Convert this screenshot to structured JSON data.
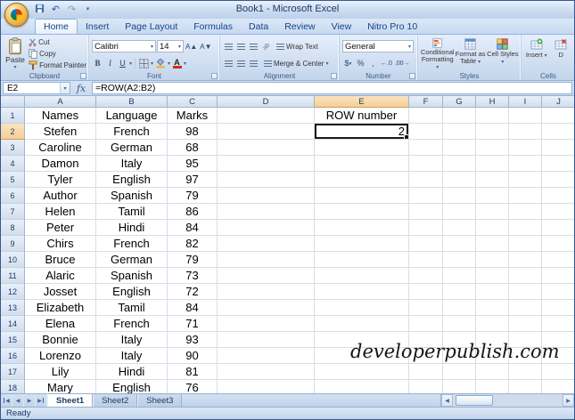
{
  "window": {
    "title": "Book1 - Microsoft Excel"
  },
  "icons": {
    "dropdown": "▾",
    "undo": "↶",
    "redo": "↷",
    "prev": "◀",
    "next": "▶",
    "letter_a": "A",
    "orientation": "ab",
    "increase_font": "A▲",
    "decrease_font": "A▼",
    "currency": "$",
    "percent": "%",
    "comma": ",",
    "increase_decimal": "←.0",
    "decrease_decimal": ".00→"
  },
  "ribbon": {
    "tabs": [
      {
        "label": "Home",
        "active": true
      },
      {
        "label": "Insert"
      },
      {
        "label": "Page Layout"
      },
      {
        "label": "Formulas"
      },
      {
        "label": "Data"
      },
      {
        "label": "Review"
      },
      {
        "label": "View"
      },
      {
        "label": "Nitro Pro 10"
      }
    ],
    "clipboard": {
      "group": "Clipboard",
      "paste": "Paste",
      "cut": "Cut",
      "copy": "Copy",
      "format_painter": "Format Painter"
    },
    "font": {
      "group": "Font",
      "family": "Calibri",
      "size": "14",
      "bold": "B",
      "italic": "I",
      "underline": "U"
    },
    "alignment": {
      "group": "Alignment",
      "wrap_text": "Wrap Text",
      "merge_center": "Merge & Center"
    },
    "number": {
      "group": "Number",
      "format": "General"
    },
    "styles": {
      "group": "Styles",
      "conditional": "Conditional Formatting",
      "format_table": "Format as Table",
      "cell_styles": "Cell Styles"
    },
    "cells": {
      "group": "Cells",
      "insert": "Insert",
      "delete": "D"
    }
  },
  "formula_bar": {
    "name_box": "E2",
    "fx": "fx",
    "formula": "=ROW(A2:B2)"
  },
  "grid": {
    "columns": [
      "A",
      "B",
      "C",
      "D",
      "E",
      "F",
      "G",
      "H",
      "I",
      "J"
    ],
    "selected": {
      "cell": "E2",
      "col": "E",
      "row": 2
    },
    "rows": [
      {
        "n": 1,
        "A": "Names",
        "B": "Language",
        "C": "Marks",
        "E": "ROW number"
      },
      {
        "n": 2,
        "A": "Stefen",
        "B": "French",
        "C": "98",
        "E": "2"
      },
      {
        "n": 3,
        "A": "Caroline",
        "B": "German",
        "C": "68"
      },
      {
        "n": 4,
        "A": "Damon",
        "B": "Italy",
        "C": "95"
      },
      {
        "n": 5,
        "A": "Tyler",
        "B": "English",
        "C": "97"
      },
      {
        "n": 6,
        "A": "Author",
        "B": "Spanish",
        "C": "79"
      },
      {
        "n": 7,
        "A": "Helen",
        "B": "Tamil",
        "C": "86"
      },
      {
        "n": 8,
        "A": "Peter",
        "B": "Hindi",
        "C": "84"
      },
      {
        "n": 9,
        "A": "Chirs",
        "B": "French",
        "C": "82"
      },
      {
        "n": 10,
        "A": "Bruce",
        "B": "German",
        "C": "79"
      },
      {
        "n": 11,
        "A": "Alaric",
        "B": "Spanish",
        "C": "73"
      },
      {
        "n": 12,
        "A": "Josset",
        "B": "English",
        "C": "72"
      },
      {
        "n": 13,
        "A": "Elizabeth",
        "B": "Tamil",
        "C": "84"
      },
      {
        "n": 14,
        "A": "Elena",
        "B": "French",
        "C": "71"
      },
      {
        "n": 15,
        "A": "Bonnie",
        "B": "Italy",
        "C": "93"
      },
      {
        "n": 16,
        "A": "Lorenzo",
        "B": "Italy",
        "C": "90"
      },
      {
        "n": 17,
        "A": "Lily",
        "B": "Hindi",
        "C": "81"
      },
      {
        "n": 18,
        "A": "Mary",
        "B": "English",
        "C": "76"
      }
    ]
  },
  "watermark": "developerpublish.com",
  "sheet_tabs": {
    "tabs": [
      "Sheet1",
      "Sheet2",
      "Sheet3"
    ],
    "active": "Sheet1"
  },
  "status_bar": {
    "ready": "Ready"
  }
}
